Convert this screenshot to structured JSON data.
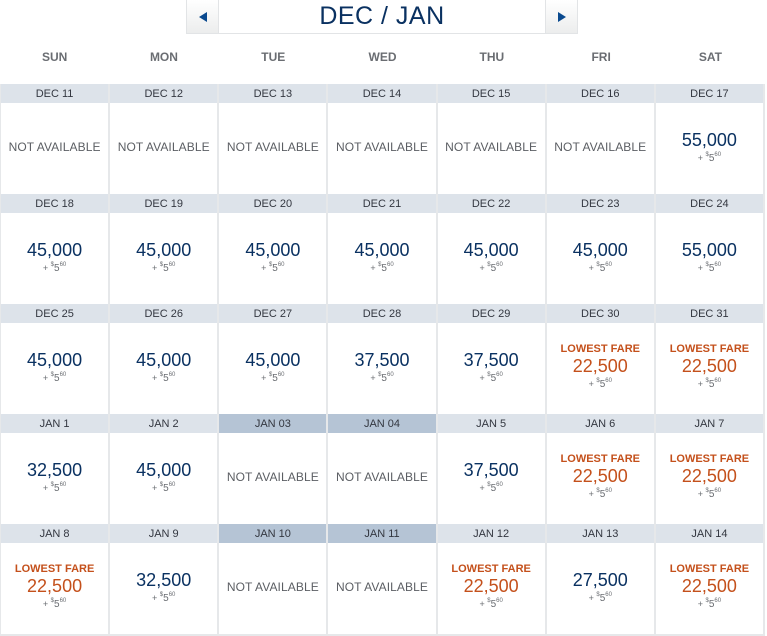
{
  "header": {
    "title": "DEC / JAN",
    "prev_icon": "triangle-left-icon",
    "next_icon": "triangle-right-icon"
  },
  "colors": {
    "accent_blue": "#0a3161",
    "lowest_orange": "#c4501b",
    "date_bar": "#dde3ea",
    "date_bar_special": "#b5c4d5"
  },
  "weekdays": [
    "SUN",
    "MON",
    "TUE",
    "WED",
    "THU",
    "FRI",
    "SAT"
  ],
  "labels": {
    "not_available": "NOT AVAILABLE",
    "lowest_fare": "LOWEST FARE",
    "fee_prefix": "+ ",
    "fee_currency": "$",
    "fee_dollars": "5",
    "fee_cents": "60"
  },
  "weeks": [
    [
      {
        "date": "DEC 11",
        "status": "na"
      },
      {
        "date": "DEC 12",
        "status": "na"
      },
      {
        "date": "DEC 13",
        "status": "na"
      },
      {
        "date": "DEC 14",
        "status": "na"
      },
      {
        "date": "DEC 15",
        "status": "na"
      },
      {
        "date": "DEC 16",
        "status": "na"
      },
      {
        "date": "DEC 17",
        "status": "fare",
        "miles": "55,000"
      }
    ],
    [
      {
        "date": "DEC 18",
        "status": "fare",
        "miles": "45,000"
      },
      {
        "date": "DEC 19",
        "status": "fare",
        "miles": "45,000"
      },
      {
        "date": "DEC 20",
        "status": "fare",
        "miles": "45,000"
      },
      {
        "date": "DEC 21",
        "status": "fare",
        "miles": "45,000"
      },
      {
        "date": "DEC 22",
        "status": "fare",
        "miles": "45,000"
      },
      {
        "date": "DEC 23",
        "status": "fare",
        "miles": "45,000"
      },
      {
        "date": "DEC 24",
        "status": "fare",
        "miles": "55,000"
      }
    ],
    [
      {
        "date": "DEC 25",
        "status": "fare",
        "miles": "45,000"
      },
      {
        "date": "DEC 26",
        "status": "fare",
        "miles": "45,000"
      },
      {
        "date": "DEC 27",
        "status": "fare",
        "miles": "45,000"
      },
      {
        "date": "DEC 28",
        "status": "fare",
        "miles": "37,500"
      },
      {
        "date": "DEC 29",
        "status": "fare",
        "miles": "37,500"
      },
      {
        "date": "DEC 30",
        "status": "lowest",
        "miles": "22,500"
      },
      {
        "date": "DEC 31",
        "status": "lowest",
        "miles": "22,500"
      }
    ],
    [
      {
        "date": "JAN 1",
        "status": "fare",
        "miles": "32,500"
      },
      {
        "date": "JAN 2",
        "status": "fare",
        "miles": "45,000"
      },
      {
        "date": "JAN 03",
        "status": "na",
        "special": true
      },
      {
        "date": "JAN 04",
        "status": "na",
        "special": true
      },
      {
        "date": "JAN 5",
        "status": "fare",
        "miles": "37,500"
      },
      {
        "date": "JAN 6",
        "status": "lowest",
        "miles": "22,500"
      },
      {
        "date": "JAN 7",
        "status": "lowest",
        "miles": "22,500"
      }
    ],
    [
      {
        "date": "JAN 8",
        "status": "lowest",
        "miles": "22,500"
      },
      {
        "date": "JAN 9",
        "status": "fare",
        "miles": "32,500"
      },
      {
        "date": "JAN 10",
        "status": "na",
        "special": true
      },
      {
        "date": "JAN 11",
        "status": "na",
        "special": true
      },
      {
        "date": "JAN 12",
        "status": "lowest",
        "miles": "22,500"
      },
      {
        "date": "JAN 13",
        "status": "fare",
        "miles": "27,500"
      },
      {
        "date": "JAN 14",
        "status": "lowest",
        "miles": "22,500"
      }
    ]
  ]
}
